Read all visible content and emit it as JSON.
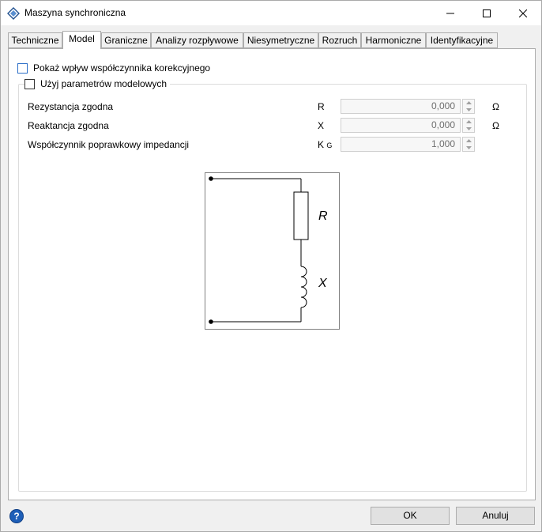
{
  "window": {
    "title": "Maszyna synchroniczna"
  },
  "tabs": [
    {
      "label": "Techniczne"
    },
    {
      "label": "Model"
    },
    {
      "label": "Graniczne"
    },
    {
      "label": "Analizy rozpływowe"
    },
    {
      "label": "Niesymetryczne"
    },
    {
      "label": "Rozruch"
    },
    {
      "label": "Harmoniczne"
    },
    {
      "label": "Identyfikacyjne"
    }
  ],
  "options": {
    "correction_label": "Pokaż wpływ współczynnika korekcyjnego",
    "model_params_label": "Użyj parametrów modelowych"
  },
  "params": [
    {
      "label": "Rezystancja zgodna",
      "symbol": "R",
      "value": "0,000",
      "unit": "Ω"
    },
    {
      "label": "Reaktancja zgodna",
      "symbol": "X",
      "value": "0,000",
      "unit": "Ω"
    },
    {
      "label": "Współczynnik poprawkowy impedancji",
      "symbol": "K",
      "symbol_sub": "G",
      "value": "1,000",
      "unit": ""
    }
  ],
  "diagram": {
    "r_label": "R",
    "x_label": "X"
  },
  "footer": {
    "ok_label": "OK",
    "cancel_label": "Anuluj",
    "help_label": "?"
  }
}
